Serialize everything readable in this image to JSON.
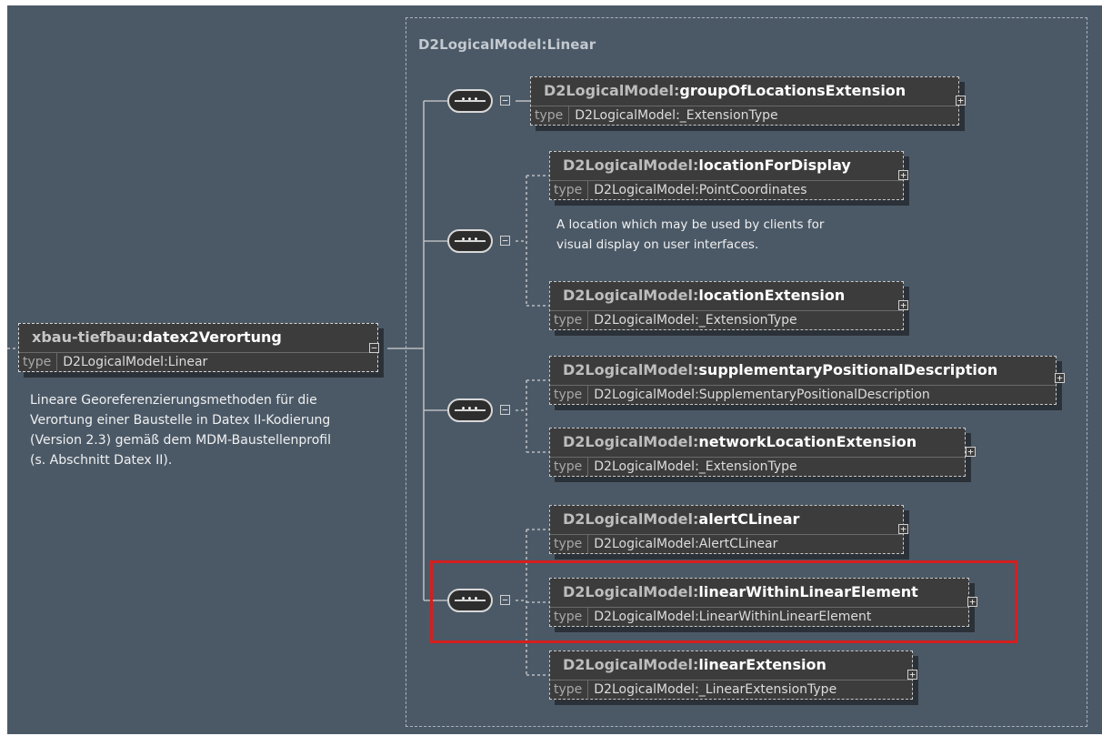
{
  "root_element": {
    "prefix": "xbau-tiefbau:",
    "name": "datex2Verortung",
    "type_label": "type",
    "type_value": "D2LogicalModel:Linear",
    "documentation": [
      "Lineare Georeferenzierungsmethoden für die",
      "Verortung einer Baustelle in Datex II-Kodierung",
      "(Version 2.3) gemäß dem MDM-Baustellenprofil",
      "(s. Abschnitt Datex II)."
    ]
  },
  "group": {
    "title": "D2LogicalModel:Linear"
  },
  "elements": [
    {
      "prefix": "D2LogicalModel:",
      "name": "groupOfLocationsExtension",
      "type_label": "type",
      "type_value": "D2LogicalModel:_ExtensionType",
      "optional": false
    },
    {
      "prefix": "D2LogicalModel:",
      "name": "locationForDisplay",
      "type_label": "type",
      "type_value": "D2LogicalModel:PointCoordinates",
      "optional": true,
      "documentation": [
        "A location which may be used by clients for",
        "visual display on user interfaces."
      ]
    },
    {
      "prefix": "D2LogicalModel:",
      "name": "locationExtension",
      "type_label": "type",
      "type_value": "D2LogicalModel:_ExtensionType",
      "optional": true
    },
    {
      "prefix": "D2LogicalModel:",
      "name": "supplementaryPositionalDescription",
      "type_label": "type",
      "type_value": "D2LogicalModel:SupplementaryPositionalDescription",
      "optional": true
    },
    {
      "prefix": "D2LogicalModel:",
      "name": "networkLocationExtension",
      "type_label": "type",
      "type_value": "D2LogicalModel:_ExtensionType",
      "optional": true
    },
    {
      "prefix": "D2LogicalModel:",
      "name": "alertCLinear",
      "type_label": "type",
      "type_value": "D2LogicalModel:AlertCLinear",
      "optional": true
    },
    {
      "prefix": "D2LogicalModel:",
      "name": "linearWithinLinearElement",
      "type_label": "type",
      "type_value": "D2LogicalModel:LinearWithinLinearElement",
      "optional": true,
      "highlighted": true
    },
    {
      "prefix": "D2LogicalModel:",
      "name": "linearExtension",
      "type_label": "type",
      "type_value": "D2LogicalModel:_LinearExtensionType",
      "optional": true
    }
  ],
  "icons": {
    "expand": "⊞",
    "collapse": "⊟",
    "sequence": "sequence-compositor-icon"
  },
  "colors": {
    "background": "#4b5967",
    "element_fill": "#3c3c3c",
    "highlight": "#d41f1f"
  }
}
